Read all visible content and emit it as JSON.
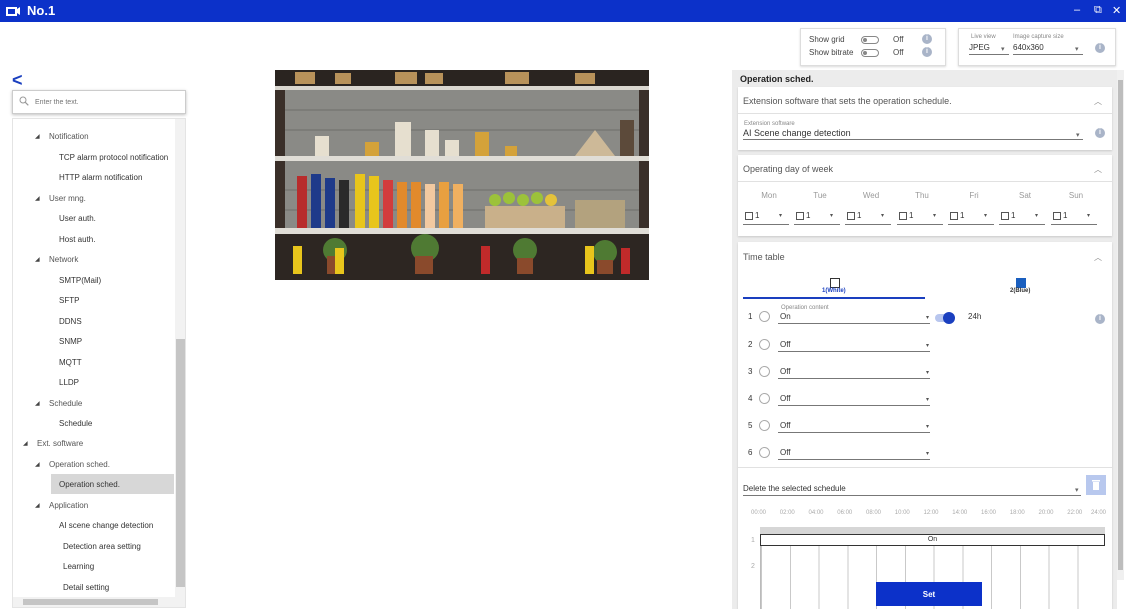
{
  "window": {
    "title": "No.1"
  },
  "display": {
    "show_grid_label": "Show grid",
    "show_grid_value": "Off",
    "show_bitrate_label": "Show bitrate",
    "show_bitrate_value": "Off",
    "live_view_label": "Live view",
    "live_view_value": "JPEG",
    "capture_size_label": "Image capture size",
    "capture_size_value": "640x360"
  },
  "sidebar": {
    "search_placeholder": "Enter the text.",
    "items": [
      {
        "label": "Notification",
        "group": true
      },
      {
        "label": "TCP alarm protocol notification"
      },
      {
        "label": "HTTP alarm notification"
      },
      {
        "label": "User mng.",
        "group": true
      },
      {
        "label": "User auth."
      },
      {
        "label": "Host auth."
      },
      {
        "label": "Network",
        "group": true
      },
      {
        "label": "SMTP(Mail)"
      },
      {
        "label": "SFTP"
      },
      {
        "label": "DDNS"
      },
      {
        "label": "SNMP"
      },
      {
        "label": "MQTT"
      },
      {
        "label": "LLDP"
      },
      {
        "label": "Schedule",
        "group": true
      },
      {
        "label": "Schedule"
      },
      {
        "label": "Ext. software",
        "group": true
      },
      {
        "label": "Operation sched.",
        "group": true
      },
      {
        "label": "Operation sched.",
        "selected": true
      },
      {
        "label": "Application",
        "group": true
      },
      {
        "label": "AI scene change detection"
      },
      {
        "label": "Detection area setting"
      },
      {
        "label": "Learning"
      },
      {
        "label": "Detail setting"
      }
    ]
  },
  "panel": {
    "title": "Operation sched.",
    "ext_header": "Extension software that sets the operation schedule.",
    "ext_field_label": "Extension software",
    "ext_field_value": "AI Scene change detection",
    "day_header": "Operating day of week",
    "days": [
      "Mon",
      "Tue",
      "Wed",
      "Thu",
      "Fri",
      "Sat",
      "Sun"
    ],
    "day_value": "1",
    "timetable_header": "Time table",
    "tabs": [
      "1(White)",
      "2(Blue)"
    ],
    "op_content_label": "Operation content",
    "rows": [
      {
        "num": "1",
        "value": "On"
      },
      {
        "num": "2",
        "value": "Off"
      },
      {
        "num": "3",
        "value": "Off"
      },
      {
        "num": "4",
        "value": "Off"
      },
      {
        "num": "5",
        "value": "Off"
      },
      {
        "num": "6",
        "value": "Off"
      }
    ],
    "row1_toggle_label": "24h",
    "delete_label": "Delete the selected schedule",
    "timeline_hours": [
      "00:00",
      "02:00",
      "04:00",
      "06:00",
      "08:00",
      "10:00",
      "12:00",
      "14:00",
      "16:00",
      "18:00",
      "20:00",
      "22:00",
      "24:00"
    ],
    "timeline_rows": [
      "1",
      "2"
    ],
    "timeline_bar_label": "On",
    "set_label": "Set"
  }
}
